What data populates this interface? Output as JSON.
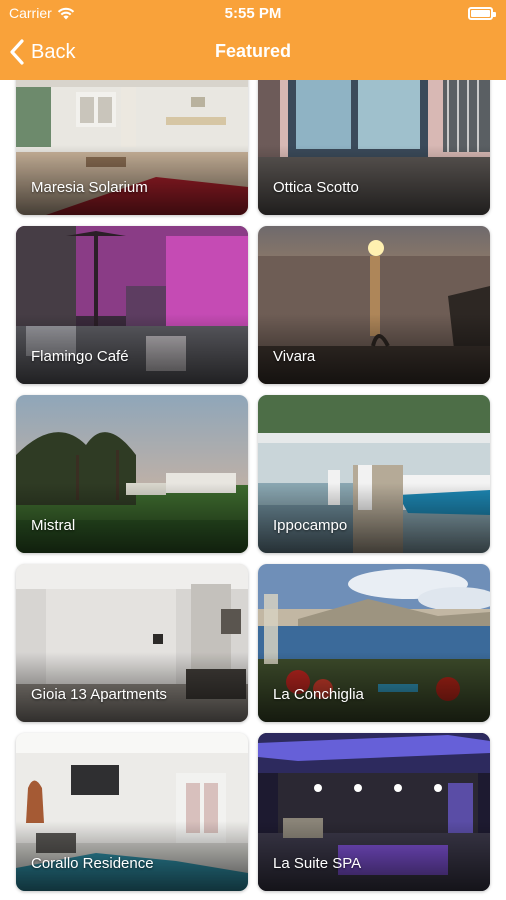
{
  "status_bar": {
    "carrier": "Carrier",
    "time": "5:55 PM"
  },
  "nav": {
    "back_label": "Back",
    "title": "Featured"
  },
  "colors": {
    "header": "#f9a23a",
    "text_on_header": "#ffffff"
  },
  "places": [
    {
      "name": "Maresia Solarium"
    },
    {
      "name": "Ottica Scotto"
    },
    {
      "name": "Flamingo Café"
    },
    {
      "name": "Vivara"
    },
    {
      "name": "Mistral"
    },
    {
      "name": "Ippocampo"
    },
    {
      "name": "Gioia 13 Apartments"
    },
    {
      "name": "La Conchiglia"
    },
    {
      "name": "Corallo Residence"
    },
    {
      "name": "La Suite SPA"
    }
  ]
}
